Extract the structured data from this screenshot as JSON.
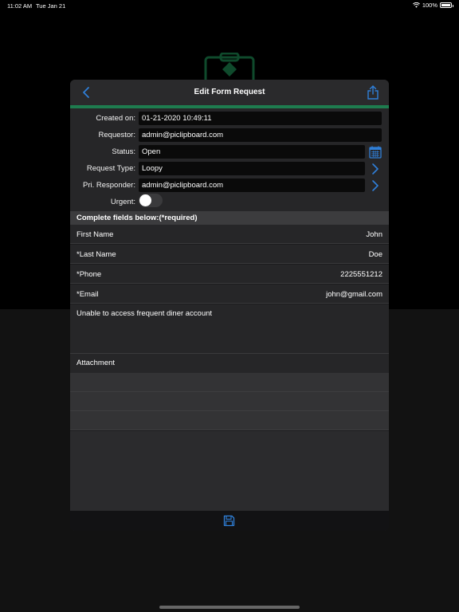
{
  "status_bar": {
    "time": "11:02 AM",
    "date": "Tue Jan 21",
    "battery": "100%"
  },
  "navbar": {
    "title": "Edit Form Request"
  },
  "form": {
    "created_on": {
      "label": "Created on:",
      "value": "01-21-2020 10:49:11"
    },
    "requestor": {
      "label": "Requestor:",
      "value": "admin@piclipboard.com"
    },
    "status": {
      "label": "Status:",
      "value": "Open"
    },
    "request_type": {
      "label": "Request Type:",
      "value": "Loopy"
    },
    "responder": {
      "label": "Pri. Responder:",
      "value": "admin@piclipboard.com"
    },
    "urgent": {
      "label": "Urgent:",
      "on": false
    }
  },
  "section_title": "Complete fields below:(*required)",
  "fields": [
    {
      "label": "First Name",
      "value": "John"
    },
    {
      "label": "*Last Name",
      "value": "Doe"
    },
    {
      "label": "*Phone",
      "value": "2225551212"
    },
    {
      "label": "*Email",
      "value": "john@gmail.com"
    }
  ],
  "notes": "Unable to access frequent diner account",
  "attachment_label": "Attachment",
  "colors": {
    "accent": "#2f7fd8",
    "green_bar": "#1e7c4f"
  }
}
